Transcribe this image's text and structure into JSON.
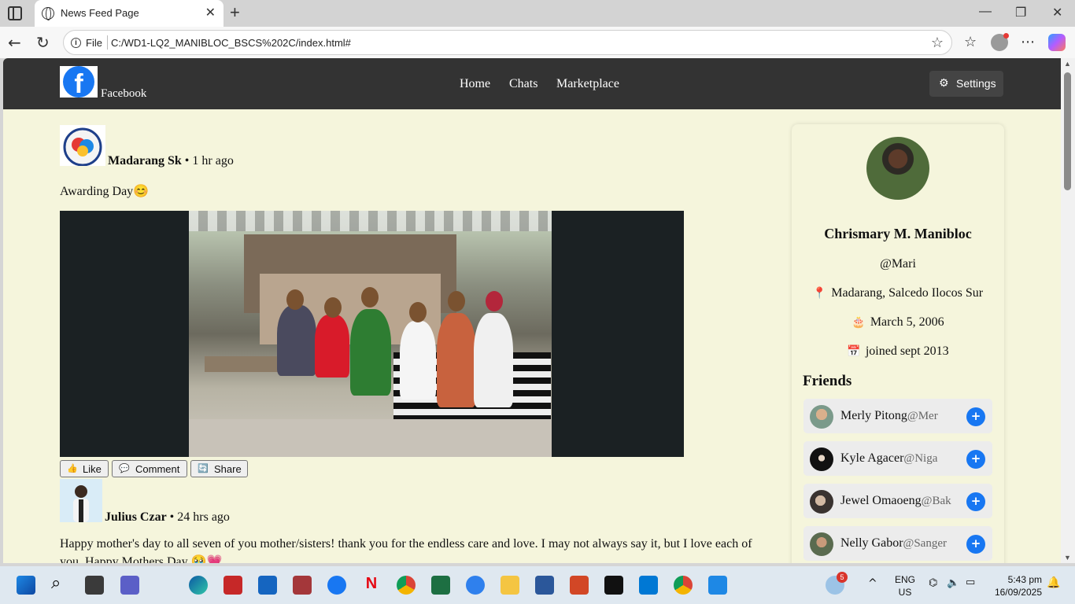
{
  "browser": {
    "tab_title": "News Feed Page",
    "scheme_label": "File",
    "url": "C:/WD1-LQ2_MANIBLOC_BSCS%202C/index.html#"
  },
  "site": {
    "logo_text": "Facebook",
    "nav": [
      "Home",
      "Chats",
      "Marketplace"
    ],
    "settings_label": "Settings"
  },
  "posts": [
    {
      "author": "Madarang Sk",
      "time": "• 1 hr ago",
      "text": "Awarding Day😊",
      "actions": {
        "like": "Like",
        "comment": "Comment",
        "share": "Share"
      }
    },
    {
      "author": "Julius Czar",
      "time": "• 24 hrs ago",
      "text": "Happy mother's day to all seven of you mother/sisters! thank you for the endless care and love. I may not always say it, but I love each of",
      "text2": "you. Happy Mothers Day 🥹💗"
    }
  ],
  "profile": {
    "name": "Chrismary M. Manibloc",
    "handle": "@Mari",
    "location_icon": "📍",
    "location": "Madarang, Salcedo Ilocos Sur",
    "birthday_icon": "🎂",
    "birthday": "March 5, 2006",
    "joined_icon": "📅",
    "joined": "joined sept 2013",
    "friends_heading": "Friends",
    "friends": [
      {
        "name": "Merly Pitong",
        "handle": "@Mer"
      },
      {
        "name": "Kyle Agacer",
        "handle": "@Niga"
      },
      {
        "name": "Jewel Omaoeng",
        "handle": "@Bak"
      },
      {
        "name": "Nelly Gabor",
        "handle": "@Sanger"
      }
    ]
  },
  "taskbar": {
    "lang": "ENG",
    "region": "US",
    "time": "5:43 pm",
    "date": "16/09/2025",
    "weather_badge": "5"
  },
  "colors": {
    "page_bg": "#f5f5dc",
    "navbar": "#333333",
    "brand_blue": "#1877f2"
  }
}
